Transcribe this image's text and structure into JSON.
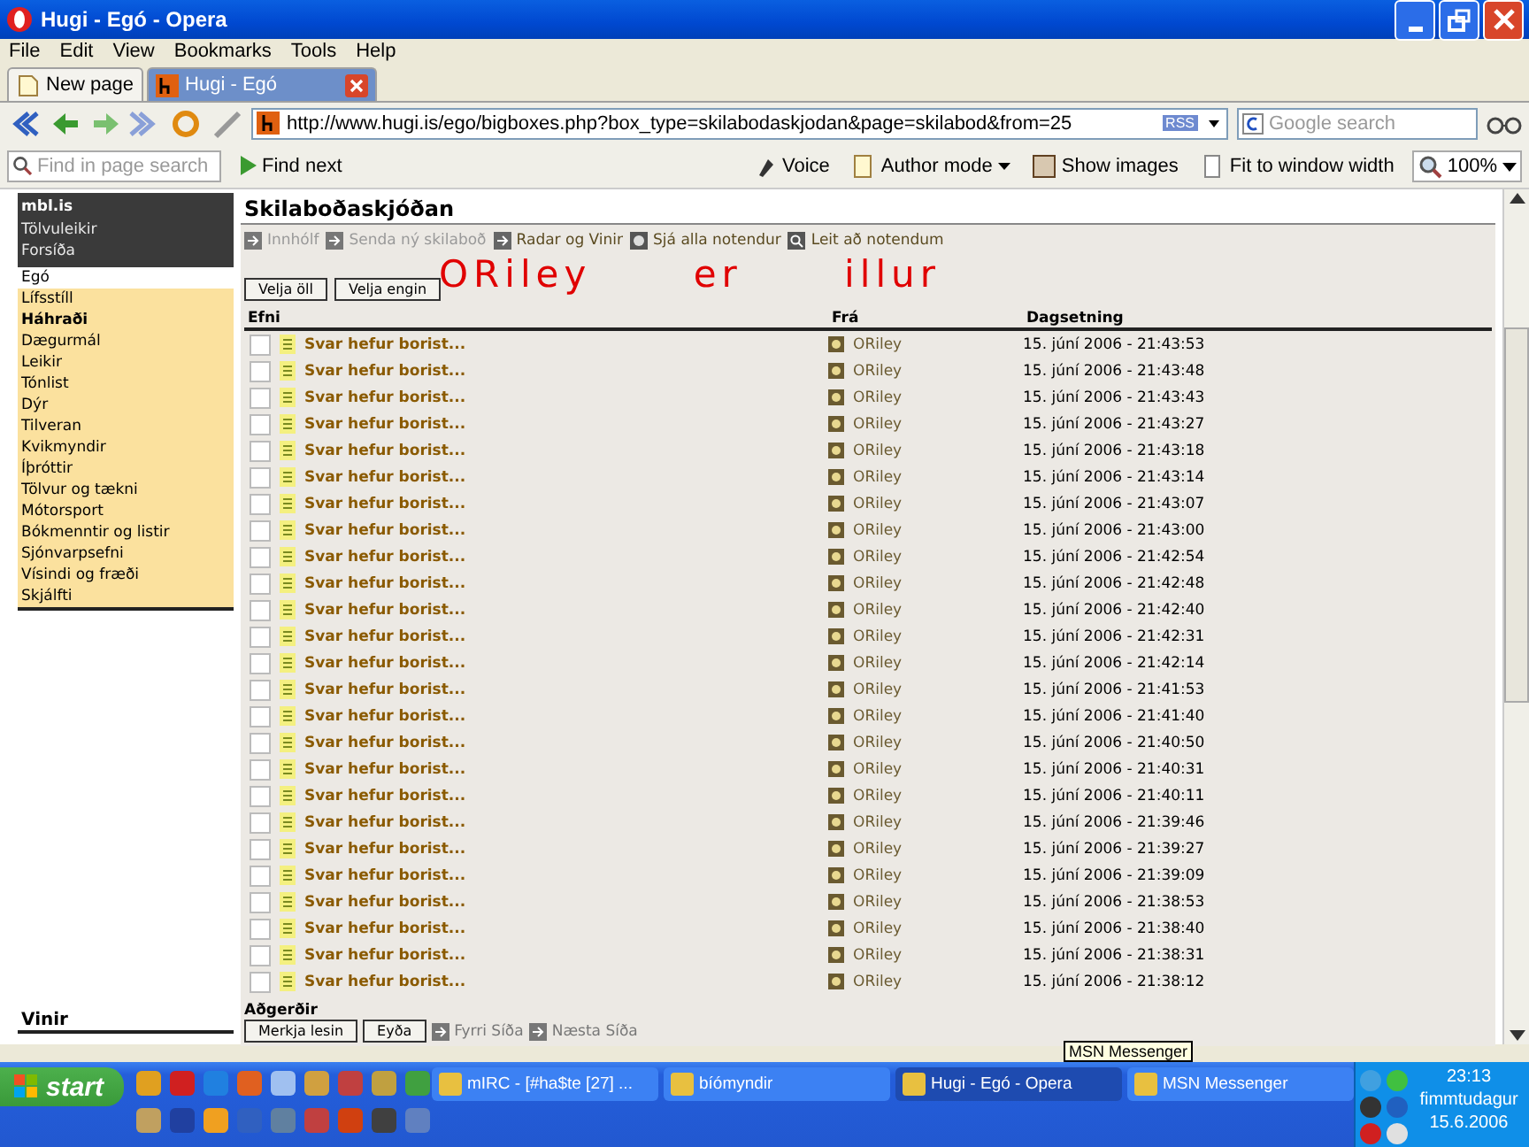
{
  "window": {
    "title": "Hugi - Egó - Opera"
  },
  "menu": [
    "File",
    "Edit",
    "View",
    "Bookmarks",
    "Tools",
    "Help"
  ],
  "tabs": [
    {
      "label": "New page",
      "selected": false
    },
    {
      "label": "Hugi - Egó",
      "selected": true
    }
  ],
  "address": {
    "url": "http://www.hugi.is/ego/bigboxes.php?box_type=skilabodaskjodan&page=skilabod&from=25",
    "rss": "RSS"
  },
  "search": {
    "placeholder": "Google search"
  },
  "find_bar": {
    "placeholder": "Find in page search",
    "find_next": "Find next",
    "buttons": [
      "Voice",
      "Author mode",
      "Show images",
      "Fit to window width"
    ],
    "zoom": "100%"
  },
  "sidebar": {
    "top_items": [
      "mbl.is",
      "Tölvuleikir",
      "Forsíða"
    ],
    "items": [
      {
        "label": "Egó",
        "selected": true,
        "bold": false
      },
      {
        "label": "Lífsstíll",
        "selected": false,
        "bold": false
      },
      {
        "label": "Háhraði",
        "selected": false,
        "bold": true
      },
      {
        "label": "Dægurmál",
        "selected": false,
        "bold": false
      },
      {
        "label": "Leikir",
        "selected": false,
        "bold": false
      },
      {
        "label": "Tónlist",
        "selected": false,
        "bold": false
      },
      {
        "label": "Dýr",
        "selected": false,
        "bold": false
      },
      {
        "label": "Tilveran",
        "selected": false,
        "bold": false
      },
      {
        "label": "Kvikmyndir",
        "selected": false,
        "bold": false
      },
      {
        "label": "Íþróttir",
        "selected": false,
        "bold": false
      },
      {
        "label": "Tölvur og tækni",
        "selected": false,
        "bold": false
      },
      {
        "label": "Mótorsport",
        "selected": false,
        "bold": false
      },
      {
        "label": "Bókmenntir og listir",
        "selected": false,
        "bold": false
      },
      {
        "label": "Sjónvarpsefni",
        "selected": false,
        "bold": false
      },
      {
        "label": "Vísindi og fræði",
        "selected": false,
        "bold": false
      },
      {
        "label": "Skjálfti",
        "selected": false,
        "bold": false
      }
    ],
    "footer": "Vinir"
  },
  "messages": {
    "title": "Skilaboðaskjóðan",
    "nav": [
      {
        "label": "Innhólf",
        "disabled": true
      },
      {
        "label": "Senda ný skilaboð",
        "disabled": true
      },
      {
        "label": "Radar og Vinir",
        "disabled": false
      },
      {
        "label": "Sjá alla notendur",
        "disabled": false
      },
      {
        "label": "Leit að notendum",
        "disabled": false
      }
    ],
    "select_buttons": [
      "Velja öll",
      "Velja engin"
    ],
    "scribble": "ORiley er illur",
    "columns": [
      "Efni",
      "Frá",
      "Dagsetning"
    ],
    "rows": [
      {
        "subject": "Svar hefur borist...",
        "from": "ORiley",
        "date": "15. júní 2006 - 21:43:53",
        "checked": false
      },
      {
        "subject": "Svar hefur borist...",
        "from": "ORiley",
        "date": "15. júní 2006 - 21:43:48",
        "checked": false
      },
      {
        "subject": "Svar hefur borist...",
        "from": "ORiley",
        "date": "15. júní 2006 - 21:43:43",
        "checked": false
      },
      {
        "subject": "Svar hefur borist...",
        "from": "ORiley",
        "date": "15. júní 2006 - 21:43:27",
        "checked": false
      },
      {
        "subject": "Svar hefur borist...",
        "from": "ORiley",
        "date": "15. júní 2006 - 21:43:18",
        "checked": false
      },
      {
        "subject": "Svar hefur borist...",
        "from": "ORiley",
        "date": "15. júní 2006 - 21:43:14",
        "checked": false
      },
      {
        "subject": "Svar hefur borist...",
        "from": "ORiley",
        "date": "15. júní 2006 - 21:43:07",
        "checked": false
      },
      {
        "subject": "Svar hefur borist...",
        "from": "ORiley",
        "date": "15. júní 2006 - 21:43:00",
        "checked": false
      },
      {
        "subject": "Svar hefur borist...",
        "from": "ORiley",
        "date": "15. júní 2006 - 21:42:54",
        "checked": false
      },
      {
        "subject": "Svar hefur borist...",
        "from": "ORiley",
        "date": "15. júní 2006 - 21:42:48",
        "checked": false
      },
      {
        "subject": "Svar hefur borist...",
        "from": "ORiley",
        "date": "15. júní 2006 - 21:42:40",
        "checked": false
      },
      {
        "subject": "Svar hefur borist...",
        "from": "ORiley",
        "date": "15. júní 2006 - 21:42:31",
        "checked": false
      },
      {
        "subject": "Svar hefur borist...",
        "from": "ORiley",
        "date": "15. júní 2006 - 21:42:14",
        "checked": false
      },
      {
        "subject": "Svar hefur borist...",
        "from": "ORiley",
        "date": "15. júní 2006 - 21:41:53",
        "checked": false
      },
      {
        "subject": "Svar hefur borist...",
        "from": "ORiley",
        "date": "15. júní 2006 - 21:41:40",
        "checked": false
      },
      {
        "subject": "Svar hefur borist...",
        "from": "ORiley",
        "date": "15. júní 2006 - 21:40:50",
        "checked": false
      },
      {
        "subject": "Svar hefur borist...",
        "from": "ORiley",
        "date": "15. júní 2006 - 21:40:31",
        "checked": false
      },
      {
        "subject": "Svar hefur borist...",
        "from": "ORiley",
        "date": "15. júní 2006 - 21:40:11",
        "checked": false
      },
      {
        "subject": "Svar hefur borist...",
        "from": "ORiley",
        "date": "15. júní 2006 - 21:39:46",
        "checked": false
      },
      {
        "subject": "Svar hefur borist...",
        "from": "ORiley",
        "date": "15. júní 2006 - 21:39:27",
        "checked": false
      },
      {
        "subject": "Svar hefur borist...",
        "from": "ORiley",
        "date": "15. júní 2006 - 21:39:09",
        "checked": false
      },
      {
        "subject": "Svar hefur borist...",
        "from": "ORiley",
        "date": "15. júní 2006 - 21:38:53",
        "checked": false
      },
      {
        "subject": "Svar hefur borist...",
        "from": "ORiley",
        "date": "15. júní 2006 - 21:38:40",
        "checked": false
      },
      {
        "subject": "Svar hefur borist...",
        "from": "ORiley",
        "date": "15. júní 2006 - 21:38:31",
        "checked": false
      },
      {
        "subject": "Svar hefur borist...",
        "from": "ORiley",
        "date": "15. júní 2006 - 21:38:12",
        "checked": false
      }
    ],
    "actions_label": "Aðgerðir",
    "action_buttons": [
      "Merkja lesin",
      "Eyða"
    ],
    "pager": [
      "Fyrri Síða",
      "Næsta Síða"
    ]
  },
  "tooltip": "MSN Messenger",
  "taskbar": {
    "start": "start",
    "tasks": [
      {
        "label": "mIRC - [#ha$te [27] ...",
        "selected": false
      },
      {
        "label": "bíómyndir",
        "selected": false
      },
      {
        "label": "Hugi - Egó - Opera",
        "selected": true
      },
      {
        "label": "MSN Messenger",
        "selected": false
      }
    ],
    "clock": {
      "time": "23:13",
      "day": "fimmtudagur",
      "date": "15.6.2006"
    }
  }
}
